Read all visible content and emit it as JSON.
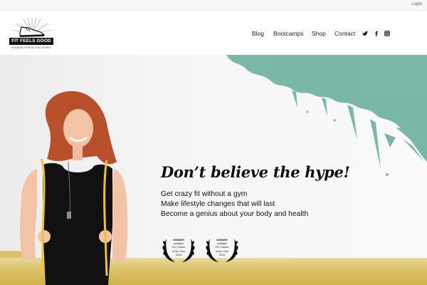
{
  "topbar": {
    "login_label": "Login"
  },
  "logo": {
    "name": "FIT FEELS GOOD",
    "tagline": "WOMENS FITNESS THAT WORKS"
  },
  "nav": {
    "items": [
      {
        "label": "Blog"
      },
      {
        "label": "Bootcamps"
      },
      {
        "label": "Shop"
      },
      {
        "label": "Contact"
      }
    ],
    "social_icons": [
      "twitter-icon",
      "facebook-icon",
      "instagram-icon"
    ]
  },
  "hero": {
    "headline": "Don’t believe the hype!",
    "bullets": [
      "Get crazy fit without a gym",
      "Make lifestyle changes that will last",
      "Become a genius about your body and health"
    ],
    "awards": [
      {
        "line1": "WINNER",
        "line2": "canfitpro",
        "line3": "Pro Trainer",
        "line4": "of the Year",
        "year": "2013"
      },
      {
        "line1": "WINNER",
        "line2": "canfitpro",
        "line3": "Pro Trainer",
        "line4": "of the Year",
        "year": "2014"
      }
    ]
  },
  "colors": {
    "splash": "#6fb3a0",
    "ground": "#d9c063",
    "hair": "#b8502c",
    "shirt": "#111111",
    "rope": "#f2c230"
  }
}
